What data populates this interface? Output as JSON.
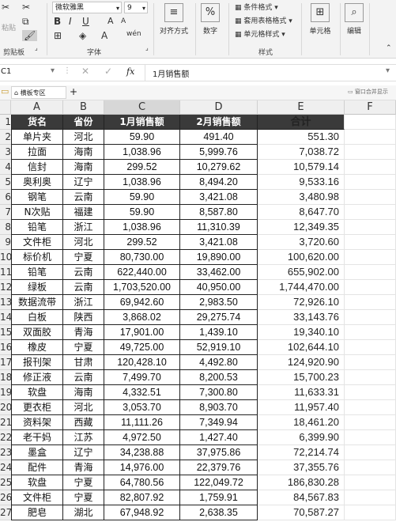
{
  "ribbon": {
    "clipboard": {
      "paste_label": "粘贴",
      "group_label": "剪贴板"
    },
    "font": {
      "font_name": "微软雅黑",
      "font_size": "9",
      "group_label": "字体",
      "bold": "B",
      "italic": "I",
      "underline": "U",
      "grow": "A",
      "shrink": "A"
    },
    "alignment": {
      "label": "对齐方式"
    },
    "number": {
      "label": "数字",
      "symbol": "%"
    },
    "styles": {
      "conditional": "条件格式",
      "table": "套用表格格式",
      "cell": "单元格样式",
      "group_label": "样式"
    },
    "cells": {
      "label": "单元格"
    },
    "editing": {
      "label": "编辑"
    }
  },
  "formula_bar": {
    "name_box": "C1",
    "fx": "fx",
    "content": "1月销售额"
  },
  "tabs": {
    "sheet_tab": "横板专区",
    "add": "+",
    "right_label": "窗口合并显示"
  },
  "columns": [
    "A",
    "B",
    "C",
    "D",
    "E",
    "F"
  ],
  "headers": {
    "a": "货名",
    "b": "省份",
    "c": "1月销售额",
    "d": "2月销售额",
    "e": "合计"
  },
  "rows": [
    {
      "n": "2",
      "a": "单片夹",
      "b": "河北",
      "c": "59.90",
      "d": "491.40",
      "e": "551.30"
    },
    {
      "n": "3",
      "a": "拉面",
      "b": "海南",
      "c": "1,038.96",
      "d": "5,999.76",
      "e": "7,038.72"
    },
    {
      "n": "4",
      "a": "信封",
      "b": "海南",
      "c": "299.52",
      "d": "10,279.62",
      "e": "10,579.14"
    },
    {
      "n": "5",
      "a": "奥利奥",
      "b": "辽宁",
      "c": "1,038.96",
      "d": "8,494.20",
      "e": "9,533.16"
    },
    {
      "n": "6",
      "a": "钢笔",
      "b": "云南",
      "c": "59.90",
      "d": "3,421.08",
      "e": "3,480.98"
    },
    {
      "n": "7",
      "a": "N次贴",
      "b": "福建",
      "c": "59.90",
      "d": "8,587.80",
      "e": "8,647.70"
    },
    {
      "n": "8",
      "a": "铅笔",
      "b": "浙江",
      "c": "1,038.96",
      "d": "11,310.39",
      "e": "12,349.35"
    },
    {
      "n": "9",
      "a": "文件柜",
      "b": "河北",
      "c": "299.52",
      "d": "3,421.08",
      "e": "3,720.60"
    },
    {
      "n": "10",
      "a": "标价机",
      "b": "宁夏",
      "c": "80,730.00",
      "d": "19,890.00",
      "e": "100,620.00"
    },
    {
      "n": "11",
      "a": "铅笔",
      "b": "云南",
      "c": "622,440.00",
      "d": "33,462.00",
      "e": "655,902.00"
    },
    {
      "n": "12",
      "a": "绿板",
      "b": "云南",
      "c": "1,703,520.00",
      "d": "40,950.00",
      "e": "1,744,470.00"
    },
    {
      "n": "13",
      "a": "数据流带",
      "b": "浙江",
      "c": "69,942.60",
      "d": "2,983.50",
      "e": "72,926.10"
    },
    {
      "n": "14",
      "a": "白板",
      "b": "陕西",
      "c": "3,868.02",
      "d": "29,275.74",
      "e": "33,143.76"
    },
    {
      "n": "15",
      "a": "双面胶",
      "b": "青海",
      "c": "17,901.00",
      "d": "1,439.10",
      "e": "19,340.10"
    },
    {
      "n": "16",
      "a": "橡皮",
      "b": "宁夏",
      "c": "49,725.00",
      "d": "52,919.10",
      "e": "102,644.10"
    },
    {
      "n": "17",
      "a": "报刊架",
      "b": "甘肃",
      "c": "120,428.10",
      "d": "4,492.80",
      "e": "124,920.90"
    },
    {
      "n": "18",
      "a": "修正液",
      "b": "云南",
      "c": "7,499.70",
      "d": "8,200.53",
      "e": "15,700.23"
    },
    {
      "n": "19",
      "a": "软盘",
      "b": "海南",
      "c": "4,332.51",
      "d": "7,300.80",
      "e": "11,633.31"
    },
    {
      "n": "20",
      "a": "更衣柜",
      "b": "河北",
      "c": "3,053.70",
      "d": "8,903.70",
      "e": "11,957.40"
    },
    {
      "n": "21",
      "a": "资料架",
      "b": "西藏",
      "c": "11,111.26",
      "d": "7,349.94",
      "e": "18,461.20"
    },
    {
      "n": "22",
      "a": "老干妈",
      "b": "江苏",
      "c": "4,972.50",
      "d": "1,427.40",
      "e": "6,399.90"
    },
    {
      "n": "23",
      "a": "墨盒",
      "b": "辽宁",
      "c": "34,238.88",
      "d": "37,975.86",
      "e": "72,214.74"
    },
    {
      "n": "24",
      "a": "配件",
      "b": "青海",
      "c": "14,976.00",
      "d": "22,379.76",
      "e": "37,355.76"
    },
    {
      "n": "25",
      "a": "软盘",
      "b": "宁夏",
      "c": "64,780.56",
      "d": "122,049.72",
      "e": "186,830.28"
    },
    {
      "n": "26",
      "a": "文件柜",
      "b": "宁夏",
      "c": "82,807.92",
      "d": "1,759.91",
      "e": "84,567.83"
    },
    {
      "n": "27",
      "a": "肥皂",
      "b": "湖北",
      "c": "67,948.92",
      "d": "2,638.35",
      "e": "70,587.27"
    }
  ]
}
